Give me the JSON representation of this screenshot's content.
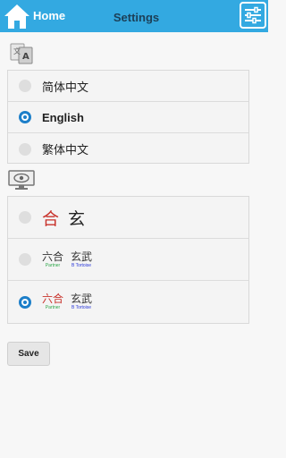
{
  "header": {
    "home_label": "Home",
    "title": "Settings",
    "color": "#33a9e1"
  },
  "language": {
    "icon": "language-icon",
    "options": [
      {
        "label": "简体中文",
        "selected": false
      },
      {
        "label": "English",
        "selected": true
      },
      {
        "label": "繁体中文",
        "selected": false
      }
    ]
  },
  "display": {
    "icon": "display-icon",
    "options": [
      {
        "glyphs": [
          "合",
          "玄"
        ],
        "selected": false
      },
      {
        "parts": [
          {
            "han": "六合",
            "sub": "Partner"
          },
          {
            "han": "玄武",
            "sub": "B Tortoise"
          }
        ],
        "selected": false
      },
      {
        "parts": [
          {
            "han": "六合",
            "sub": "Partner"
          },
          {
            "han": "玄武",
            "sub": "B Tortoise"
          }
        ],
        "selected": true
      }
    ]
  },
  "save_label": "Save"
}
